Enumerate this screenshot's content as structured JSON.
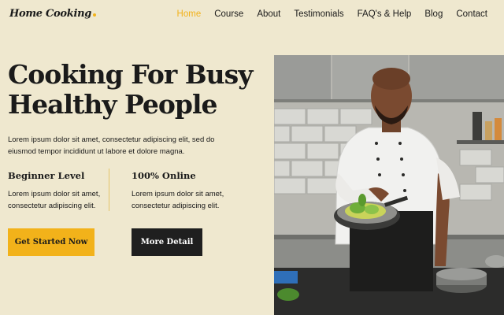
{
  "brand": {
    "name": "Home Cooking",
    "accent": "#f2b21a"
  },
  "nav": {
    "items": [
      {
        "label": "Home",
        "active": true
      },
      {
        "label": "Course"
      },
      {
        "label": "About"
      },
      {
        "label": "Testimonials"
      },
      {
        "label": "FAQ's & Help"
      },
      {
        "label": "Blog"
      },
      {
        "label": "Contact"
      }
    ]
  },
  "hero": {
    "title": "Cooking For Busy Healthy People",
    "description": "Lorem ipsum dolor sit amet, consectetur adipiscing elit, sed do eiusmod tempor incididunt ut labore et dolore magna."
  },
  "features": [
    {
      "title": "Beginner Level",
      "text": "Lorem ipsum dolor sit amet, consectetur adipiscing elit."
    },
    {
      "title": "100% Online",
      "text": "Lorem ipsum dolor sit amet, consectetur adipiscing elit."
    }
  ],
  "buttons": {
    "primary": "Get Started Now",
    "secondary": "More Detail"
  },
  "image": {
    "subject": "chef-cooking-photo"
  }
}
